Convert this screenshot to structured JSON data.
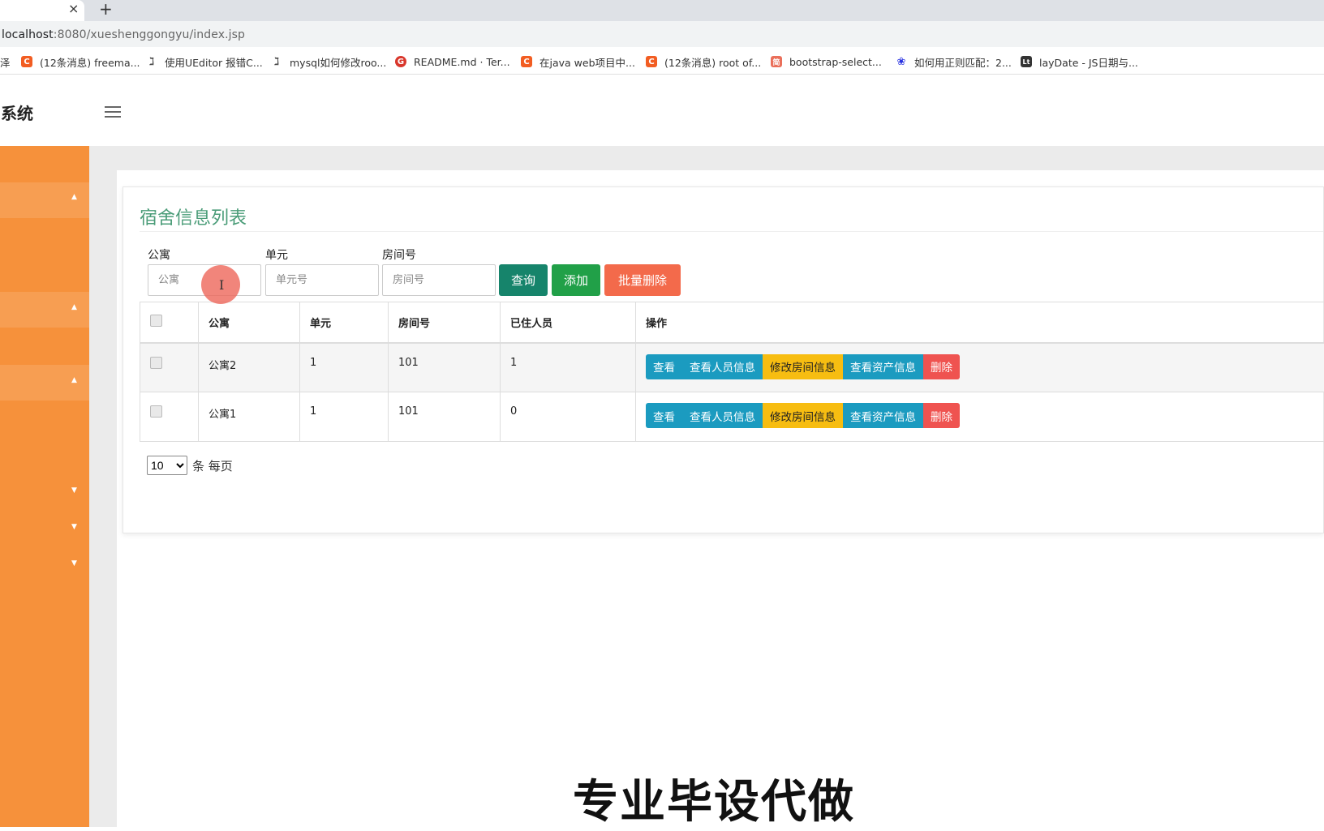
{
  "browser": {
    "tab_close": "×",
    "new_tab": "+",
    "url_host": "localhost",
    "url_rest": ":8080/xueshenggongyu/index.jsp",
    "bookmarks": [
      {
        "label": "泽",
        "icon": "truncated",
        "color": ""
      },
      {
        "label": "(12条消息) freema...",
        "icon": "C",
        "color": "#f25d22"
      },
      {
        "label": "使用UEditor 报错C...",
        "icon": "tag-icon",
        "color": ""
      },
      {
        "label": "mysql如何修改roo...",
        "icon": "tag-icon",
        "color": ""
      },
      {
        "label": "README.md · Ter...",
        "icon": "G",
        "color": "#d9372c"
      },
      {
        "label": "在java web项目中...",
        "icon": "C",
        "color": "#f25d22"
      },
      {
        "label": "(12条消息) root of...",
        "icon": "C",
        "color": "#f25d22"
      },
      {
        "label": "bootstrap-select...",
        "icon": "简",
        "color": "#ea6f5a"
      },
      {
        "label": "如何用正则匹配：2...",
        "icon": "paw-icon",
        "color": "#2932e1"
      },
      {
        "label": "layDate - JS日期与...",
        "icon": "Lt",
        "color": "#333333"
      }
    ]
  },
  "header": {
    "brand": "系统",
    "menu_icon": "hamburger-icon"
  },
  "sidebar": {
    "accent": "#f6913b"
  },
  "page": {
    "title": "宿舍信息列表",
    "filters": [
      {
        "label": "公寓",
        "placeholder": "公寓"
      },
      {
        "label": "单元",
        "placeholder": "单元号"
      },
      {
        "label": "房间号",
        "placeholder": "房间号"
      }
    ],
    "buttons": {
      "search": "查询",
      "add": "添加",
      "batch_delete": "批量删除"
    },
    "table": {
      "headers": [
        "公寓",
        "单元",
        "房间号",
        "已住人员",
        "操作"
      ],
      "rows": [
        {
          "apartment": "公寓2",
          "unit": "1",
          "room": "101",
          "occupants": "1"
        },
        {
          "apartment": "公寓1",
          "unit": "1",
          "room": "101",
          "occupants": "0"
        }
      ],
      "actions": [
        "查看",
        "查看人员信息",
        "修改房间信息",
        "查看资产信息",
        "删除"
      ]
    },
    "pagination": {
      "page_size": "10",
      "suffix": "条 每页"
    }
  },
  "colors": {
    "title_green": "#4a9c78",
    "search": "#16846b",
    "add": "#21a048",
    "batch_delete": "#f36a4b",
    "info": "#1b9bc0",
    "warning": "#f7bd11",
    "danger": "#ef5350"
  },
  "overlay": {
    "watermark": "专业毕设代做"
  }
}
